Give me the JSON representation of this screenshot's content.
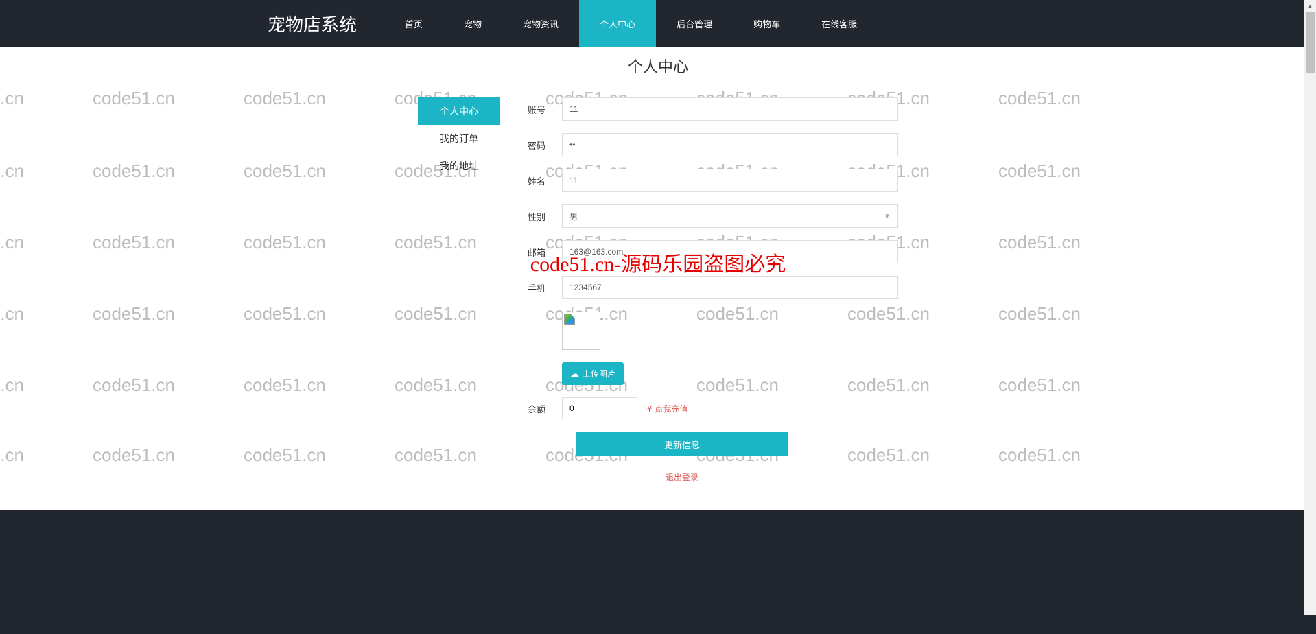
{
  "brand": "宠物店系统",
  "nav": {
    "items": [
      {
        "label": "首页"
      },
      {
        "label": "宠物"
      },
      {
        "label": "宠物资讯"
      },
      {
        "label": "个人中心"
      },
      {
        "label": "后台管理"
      },
      {
        "label": "购物车"
      },
      {
        "label": "在线客服"
      }
    ],
    "active_index": 3
  },
  "page_title": "个人中心",
  "sidebar": {
    "items": [
      {
        "label": "个人中心"
      },
      {
        "label": "我的订单"
      },
      {
        "label": "我的地址"
      }
    ],
    "active_index": 0
  },
  "form": {
    "account": {
      "label": "账号",
      "value": "11"
    },
    "password": {
      "label": "密码",
      "value": "••"
    },
    "name": {
      "label": "姓名",
      "value": "11"
    },
    "gender": {
      "label": "性别",
      "value": "男"
    },
    "email": {
      "label": "邮箱",
      "value": "163@163.com"
    },
    "phone": {
      "label": "手机",
      "value": "1234567"
    },
    "upload_label": "上传图片",
    "balance": {
      "label": "余额",
      "value": "0",
      "recharge_label": "点我充值",
      "currency_symbol": "¥"
    },
    "update_button": "更新信息",
    "logout": "退出登录"
  },
  "watermark_text": "code51.cn",
  "central_watermark": "code51.cn-源码乐园盗图必究"
}
